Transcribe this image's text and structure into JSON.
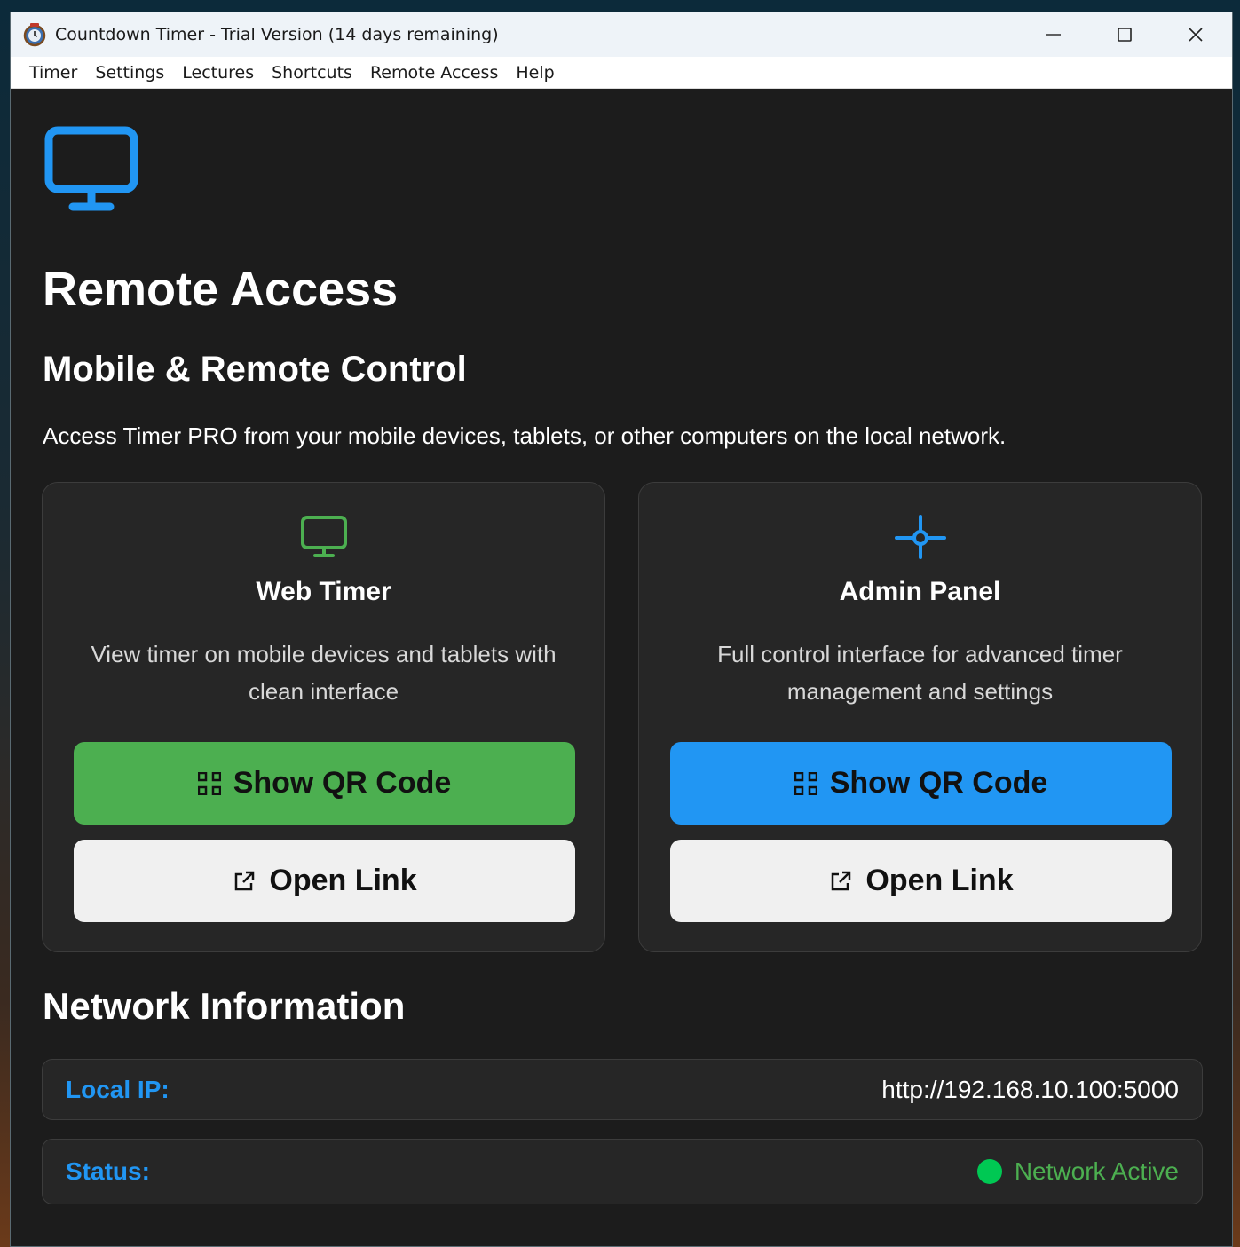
{
  "window": {
    "title": "Countdown Timer - Trial Version (14 days remaining)",
    "app_icon": "clock-app-icon"
  },
  "menu": {
    "items": [
      {
        "label": "Timer"
      },
      {
        "label": "Settings"
      },
      {
        "label": "Lectures"
      },
      {
        "label": "Shortcuts"
      },
      {
        "label": "Remote Access"
      },
      {
        "label": "Help"
      }
    ]
  },
  "page": {
    "hero_icon": "monitor-icon",
    "title": "Remote Access",
    "subtitle": "Mobile & Remote Control",
    "description": "Access Timer PRO from your mobile devices, tablets, or other computers on the local network."
  },
  "cards": [
    {
      "icon": "monitor-icon",
      "icon_color": "#4caf50",
      "title": "Web Timer",
      "description": "View timer on mobile devices and tablets with clean interface",
      "qr_label": "Show QR Code",
      "qr_color": "#4caf50",
      "link_label": "Open Link"
    },
    {
      "icon": "crosshair-icon",
      "icon_color": "#2196f3",
      "title": "Admin Panel",
      "description": "Full control interface for advanced timer management and settings",
      "qr_label": "Show QR Code",
      "qr_color": "#2196f3",
      "link_label": "Open Link"
    }
  ],
  "network": {
    "heading": "Network Information",
    "local_ip_label": "Local IP:",
    "local_ip_value": "http://192.168.10.100:5000",
    "status_label": "Status:",
    "status_value": "Network Active",
    "status_color": "#00c853"
  },
  "colors": {
    "accent_blue": "#2196f3",
    "accent_green": "#4caf50",
    "background": "#1c1c1c"
  }
}
